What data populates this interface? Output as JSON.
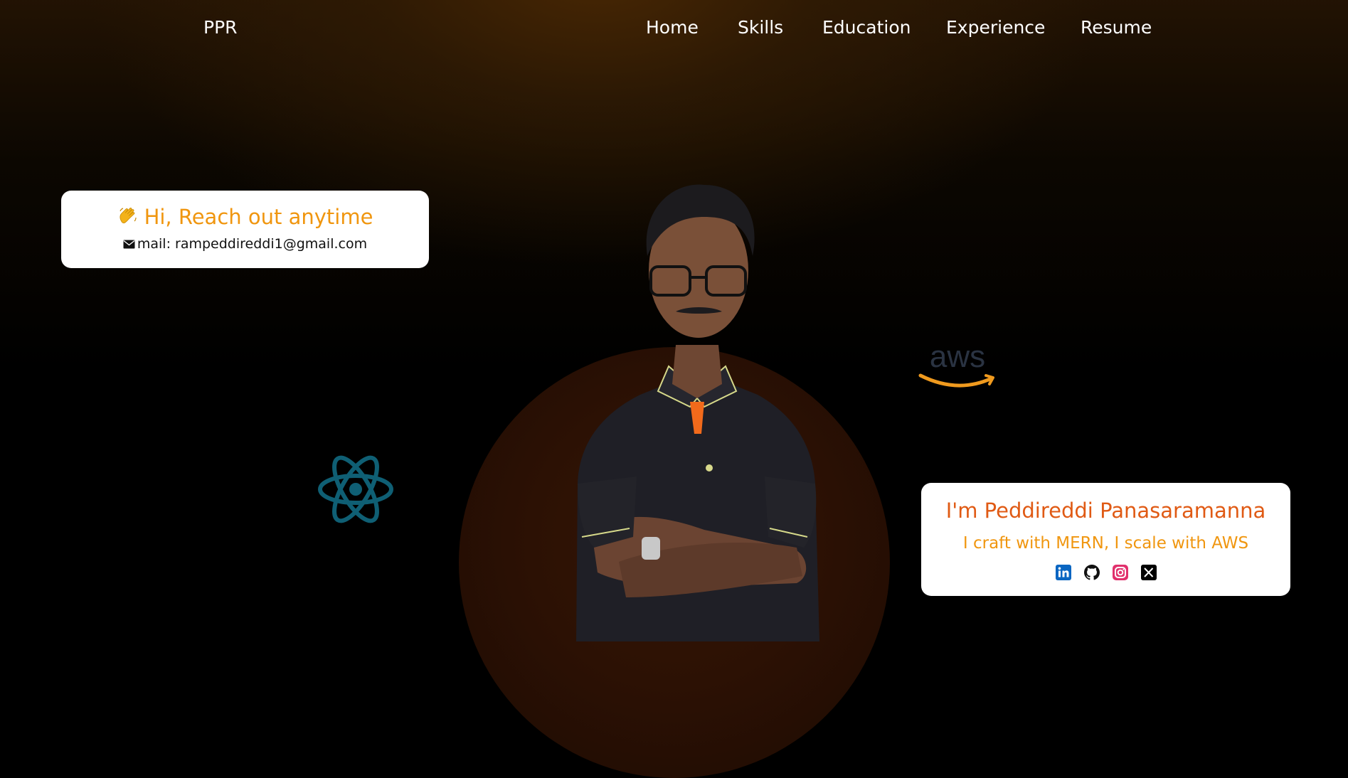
{
  "header": {
    "brand": "PPR",
    "nav": [
      {
        "label": "Home"
      },
      {
        "label": "Skills"
      },
      {
        "label": "Education"
      },
      {
        "label": "Experience"
      },
      {
        "label": "Resume"
      }
    ]
  },
  "contact_card": {
    "greeting": "Hi, Reach out anytime",
    "greeting_icon": "waving-hand-icon",
    "mail_icon": "envelope-icon",
    "mail_text": "mail: rampeddireddi1@gmail.com"
  },
  "intro_card": {
    "name": "I'm Peddireddi Panasaramanna",
    "tagline": "I craft with MERN, I scale with AWS",
    "socials": [
      {
        "icon": "linkedin-icon",
        "color": "#0a66c2"
      },
      {
        "icon": "github-icon",
        "color": "#111111"
      },
      {
        "icon": "instagram-icon",
        "color": "#e1306c"
      },
      {
        "icon": "x-icon",
        "color": "#000000"
      }
    ]
  },
  "decorations": {
    "aws_logo": "aws",
    "react_logo": "react-icon",
    "aws_text_color": "#2a3342",
    "aws_smile_color": "#f09a1e",
    "react_color": "#0f5f74"
  },
  "colors": {
    "accent_orange": "#f0960f",
    "name_orange": "#e05a14",
    "background": "#000000"
  }
}
